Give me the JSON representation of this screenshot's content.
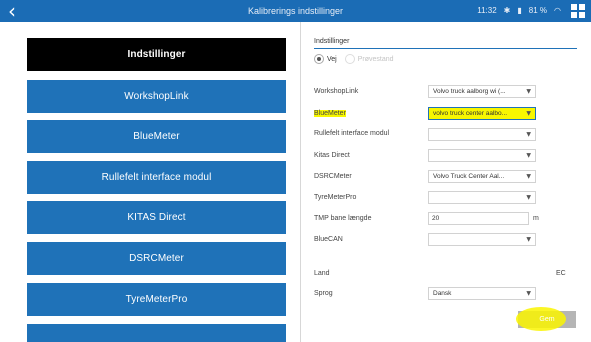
{
  "topbar": {
    "back_icon": "chevron-left-icon",
    "title": "Kalibrerings indstillinger",
    "time": "11:32",
    "battery": "81 %",
    "icons": [
      "bluetooth-icon",
      "battery-icon",
      "wifi-icon",
      "grid-icon"
    ]
  },
  "nav": {
    "items": [
      {
        "label": "Indstillinger"
      },
      {
        "label": "WorkshopLink"
      },
      {
        "label": "BlueMeter"
      },
      {
        "label": "Rullefelt interface modul"
      },
      {
        "label": "KITAS Direct"
      },
      {
        "label": "DSRCMeter"
      },
      {
        "label": "TyreMeterPro"
      }
    ],
    "active_index": 0
  },
  "settings": {
    "section_title": "Indstillinger",
    "radio": {
      "option1": "Vej",
      "option2": "Prøvestand",
      "selected": "option1"
    },
    "fields": {
      "workshoplink": {
        "label": "WorkshopLink",
        "value": "Volvo truck aalborg wi (..."
      },
      "bluemeter": {
        "label": "BlueMeter",
        "value": "volvo truck center aalbo..."
      },
      "rullefelt": {
        "label": "Rullefelt interface modul",
        "value": ""
      },
      "kitas": {
        "label": "Kitas Direct",
        "value": ""
      },
      "dsrcmeter": {
        "label": "DSRCMeter",
        "value": "Volvo Truck Center Aal..."
      },
      "tyremeterpro": {
        "label": "TyreMeterPro",
        "value": ""
      },
      "tmp": {
        "label": "TMP bane længde",
        "value": "20",
        "unit": "m"
      },
      "bluecan": {
        "label": "BlueCAN",
        "value": ""
      }
    },
    "land": {
      "label": "Land",
      "value": "EC"
    },
    "sprog": {
      "label": "Sprog",
      "value": "Dansk"
    },
    "save_label": "Gem"
  },
  "colors": {
    "accent": "#1f72b8",
    "active_nav": "#000000",
    "highlight": "#f7f700",
    "save_disabled": "#b5b5b5"
  }
}
